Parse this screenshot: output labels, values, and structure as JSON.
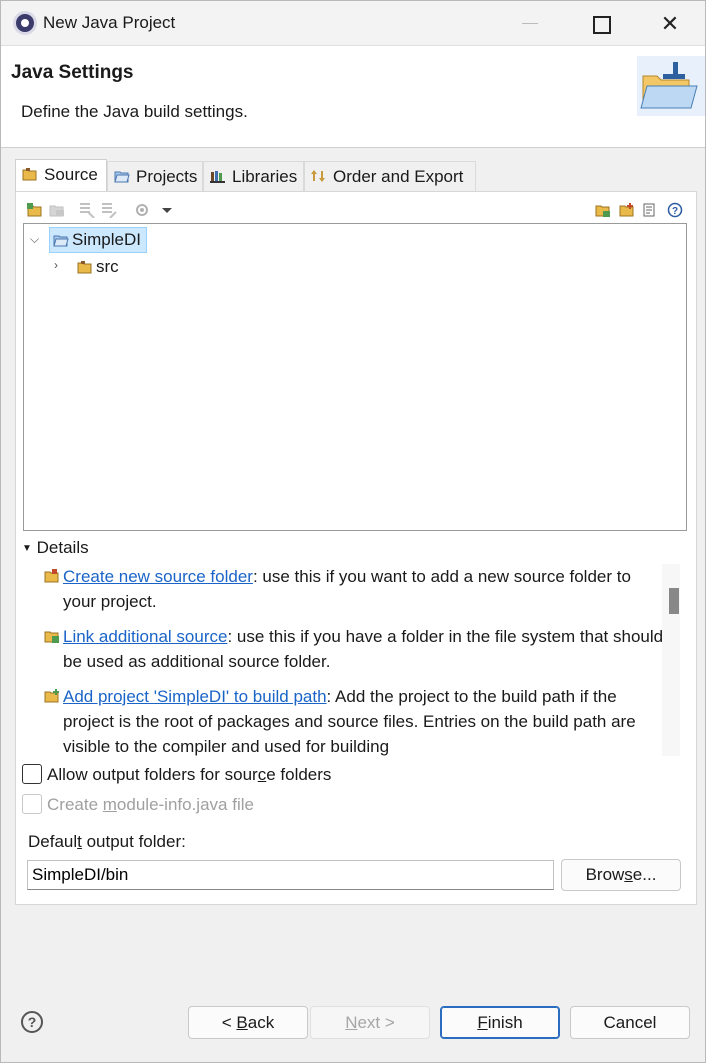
{
  "window": {
    "title": "New Java Project"
  },
  "banner": {
    "title": "Java Settings",
    "description": "Define the Java build settings."
  },
  "tabs": [
    {
      "label": "Source",
      "icon": "source-folder-icon",
      "active": true
    },
    {
      "label": "Projects",
      "icon": "projects-icon",
      "active": false
    },
    {
      "label": "Libraries",
      "icon": "libraries-icon",
      "active": false
    },
    {
      "label": "Order and Export",
      "icon": "order-export-icon",
      "active": false
    }
  ],
  "tree": {
    "project": "SimpleDI",
    "children": [
      {
        "label": "src"
      }
    ]
  },
  "details": {
    "heading": "Details",
    "items": [
      {
        "link": "Create new source folder",
        "text": ": use this if you want to add a new source folder to your project."
      },
      {
        "link": "Link additional source",
        "text": ": use this if you have a folder in the file system that should be used as additional source folder."
      },
      {
        "link": "Add project 'SimpleDI' to build path",
        "text": ": Add the project to the build path if the project is the root of packages and source files. Entries on the build path are visible to the compiler and used for building"
      }
    ]
  },
  "options": {
    "allow_output": {
      "pre": "Allow output folders for sour",
      "accel": "c",
      "post": "e folders",
      "checked": false
    },
    "module_info": {
      "pre": "Create ",
      "accel": "m",
      "post": "odule-info.java file",
      "checked": false,
      "enabled": false
    }
  },
  "output": {
    "label_pre": "Defaul",
    "label_accel": "t",
    "label_post": " output folder:",
    "value": "SimpleDI/bin",
    "browse_pre": "Brow",
    "browse_accel": "s",
    "browse_post": "e..."
  },
  "footer": {
    "help": "?",
    "back_pre": "< ",
    "back_accel": "B",
    "back_post": "ack",
    "next_accel": "N",
    "next_post": "ext >",
    "finish_accel": "F",
    "finish_post": "inish",
    "cancel": "Cancel"
  }
}
